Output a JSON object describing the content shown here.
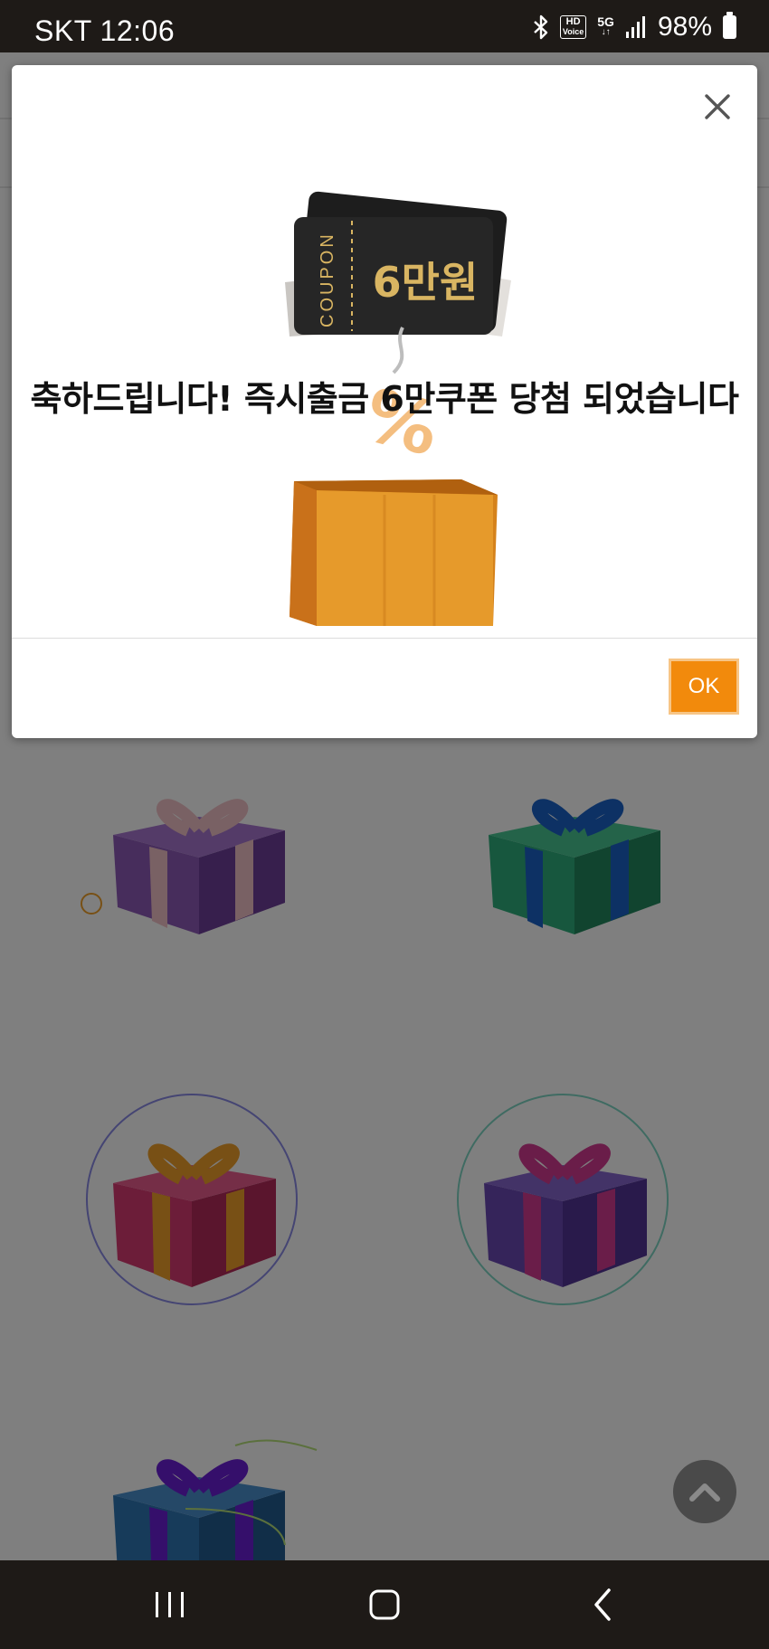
{
  "status_bar": {
    "time": "SKT 12:06",
    "battery": "98%",
    "hd_voice_top": "HD",
    "hd_voice_bottom": "Voice",
    "network": "5G",
    "icons": [
      "bluetooth-icon",
      "hd-voice-icon",
      "5g-icon",
      "signal-icon",
      "battery-icon"
    ]
  },
  "modal": {
    "coupon_side_text": "COUPON",
    "coupon_amount": "6만원",
    "message": "축하드립니다! 즉시출금 6만쿠폰 당첨 되었습니다",
    "ok_label": "OK",
    "accent_color": "#f28a0c"
  },
  "gifts": [
    {
      "box": "#8e5bb8",
      "ribbon": "#f3c3c8"
    },
    {
      "box": "#2fae7c",
      "ribbon": "#1a63c9"
    },
    {
      "box": "#d93b73",
      "ribbon": "#f0a12a"
    },
    {
      "box": "#6a49b5",
      "ribbon": "#d43a92"
    },
    {
      "box": "#2f76b5",
      "ribbon": "#6a1fd6"
    }
  ],
  "navbar": {
    "icons": [
      "recent-apps-icon",
      "home-icon",
      "back-icon"
    ]
  }
}
